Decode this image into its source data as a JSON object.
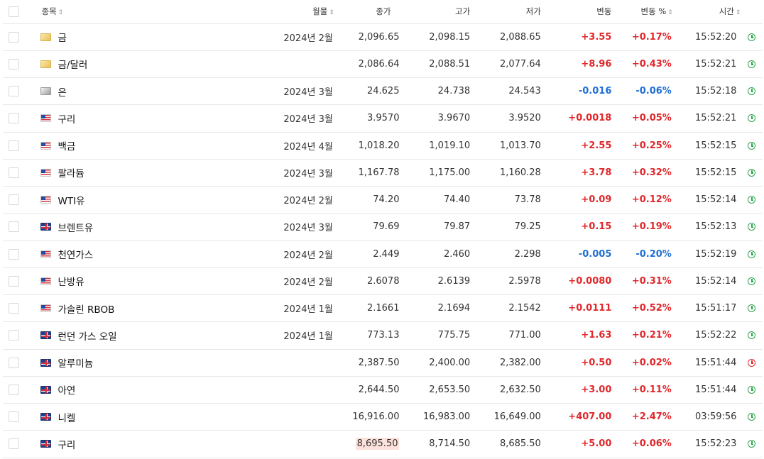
{
  "columns": {
    "name": "종목",
    "month": "월물",
    "close": "종가",
    "high": "고가",
    "low": "저가",
    "change": "변동",
    "change_pct": "변동 %",
    "time": "시간"
  },
  "colors": {
    "up": "#e0272b",
    "down": "#1f6fd4",
    "live": "#2ea44f"
  },
  "rows": [
    {
      "flag": "gold-icon",
      "name": "금",
      "month": "2024년 2월",
      "close": "2,096.65",
      "high": "2,098.15",
      "low": "2,088.65",
      "change": "+3.55",
      "pct": "+0.17%",
      "time": "15:52:20",
      "dir": "up",
      "clock": "green"
    },
    {
      "flag": "gold-icon",
      "name": "금/달러",
      "month": "",
      "close": "2,086.64",
      "high": "2,088.51",
      "low": "2,077.64",
      "change": "+8.96",
      "pct": "+0.43%",
      "time": "15:52:21",
      "dir": "up",
      "clock": "green"
    },
    {
      "flag": "silver-icon",
      "name": "은",
      "month": "2024년 3월",
      "close": "24.625",
      "high": "24.738",
      "low": "24.543",
      "change": "-0.016",
      "pct": "-0.06%",
      "time": "15:52:18",
      "dir": "down",
      "clock": "green"
    },
    {
      "flag": "us-flag-icon",
      "name": "구리",
      "month": "2024년 3월",
      "close": "3.9570",
      "high": "3.9670",
      "low": "3.9520",
      "change": "+0.0018",
      "pct": "+0.05%",
      "time": "15:52:21",
      "dir": "up",
      "clock": "green"
    },
    {
      "flag": "us-flag-icon",
      "name": "백금",
      "month": "2024년 4월",
      "close": "1,018.20",
      "high": "1,019.10",
      "low": "1,013.70",
      "change": "+2.55",
      "pct": "+0.25%",
      "time": "15:52:15",
      "dir": "up",
      "clock": "green"
    },
    {
      "flag": "us-flag-icon",
      "name": "팔라듐",
      "month": "2024년 3월",
      "close": "1,167.78",
      "high": "1,175.00",
      "low": "1,160.28",
      "change": "+3.78",
      "pct": "+0.32%",
      "time": "15:52:15",
      "dir": "up",
      "clock": "green"
    },
    {
      "flag": "us-flag-icon",
      "name": "WTI유",
      "month": "2024년 2월",
      "close": "74.20",
      "high": "74.40",
      "low": "73.78",
      "change": "+0.09",
      "pct": "+0.12%",
      "time": "15:52:14",
      "dir": "up",
      "clock": "green"
    },
    {
      "flag": "uk-flag-icon",
      "name": "브렌트유",
      "month": "2024년 3월",
      "close": "79.69",
      "high": "79.87",
      "low": "79.25",
      "change": "+0.15",
      "pct": "+0.19%",
      "time": "15:52:13",
      "dir": "up",
      "clock": "green"
    },
    {
      "flag": "us-flag-icon",
      "name": "천연가스",
      "month": "2024년 2월",
      "close": "2.449",
      "high": "2.460",
      "low": "2.298",
      "change": "-0.005",
      "pct": "-0.20%",
      "time": "15:52:19",
      "dir": "down",
      "clock": "green"
    },
    {
      "flag": "us-flag-icon",
      "name": "난방유",
      "month": "2024년 2월",
      "close": "2.6078",
      "high": "2.6139",
      "low": "2.5978",
      "change": "+0.0080",
      "pct": "+0.31%",
      "time": "15:52:14",
      "dir": "up",
      "clock": "green"
    },
    {
      "flag": "us-flag-icon",
      "name": "가솔린 RBOB",
      "month": "2024년 1월",
      "close": "2.1661",
      "high": "2.1694",
      "low": "2.1542",
      "change": "+0.0111",
      "pct": "+0.52%",
      "time": "15:51:17",
      "dir": "up",
      "clock": "green"
    },
    {
      "flag": "uk-flag-icon",
      "name": "런던 가스 오일",
      "month": "2024년 1월",
      "close": "773.13",
      "high": "775.75",
      "low": "771.00",
      "change": "+1.63",
      "pct": "+0.21%",
      "time": "15:52:22",
      "dir": "up",
      "clock": "green"
    },
    {
      "flag": "uk-flag-icon",
      "name": "알루미늄",
      "month": "",
      "close": "2,387.50",
      "high": "2,400.00",
      "low": "2,382.00",
      "change": "+0.50",
      "pct": "+0.02%",
      "time": "15:51:44",
      "dir": "up",
      "clock": "red"
    },
    {
      "flag": "uk-flag-icon",
      "name": "아연",
      "month": "",
      "close": "2,644.50",
      "high": "2,653.50",
      "low": "2,632.50",
      "change": "+3.00",
      "pct": "+0.11%",
      "time": "15:51:44",
      "dir": "up",
      "clock": "green"
    },
    {
      "flag": "uk-flag-icon",
      "name": "니켈",
      "month": "",
      "close": "16,916.00",
      "high": "16,983.00",
      "low": "16,649.00",
      "change": "+407.00",
      "pct": "+2.47%",
      "time": "03:59:56",
      "dir": "up",
      "clock": "green"
    },
    {
      "flag": "uk-flag-icon",
      "name": "구리",
      "month": "",
      "close": "8,695.50",
      "high": "8,714.50",
      "low": "8,685.50",
      "change": "+5.00",
      "pct": "+0.06%",
      "time": "15:52:23",
      "dir": "up",
      "clock": "green",
      "close_highlight": true
    }
  ]
}
